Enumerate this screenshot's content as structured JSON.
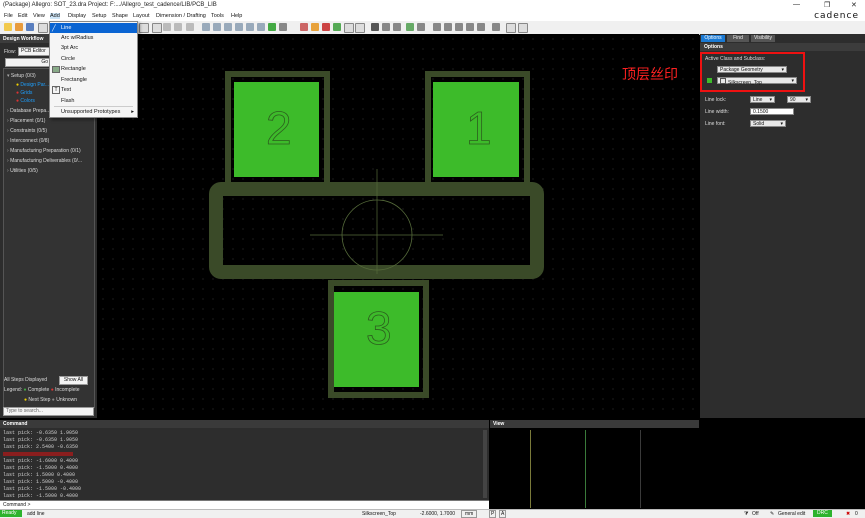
{
  "window": {
    "title": "(Package) Allegro: SOT_23.dra  Project: F:.../Allegro_test_cadence/LIB/PCB_LIB",
    "controls": [
      "—",
      "❐",
      "✕"
    ]
  },
  "menubar": {
    "items": [
      "File",
      "Edit",
      "View",
      "Add",
      "Display",
      "Setup",
      "Shape",
      "Layout",
      "Dimension / Drafting",
      "Tools",
      "Help"
    ],
    "brand": "cadence"
  },
  "add_menu": {
    "items": [
      "Line",
      "Arc w/Radius",
      "3pt Arc",
      "Circle",
      "Rectangle",
      "Frectangle",
      "Text",
      "Flash",
      "Unsupported Prototypes"
    ],
    "highlighted": "Line"
  },
  "left_panel": {
    "title": "Design Workflow",
    "flow_label": "Flow:",
    "flow_value": "PCB Editor",
    "goto_label": "Go To",
    "tree": [
      {
        "label": "Setup  (0/3)"
      },
      {
        "label": "Design Par..."
      },
      {
        "label": "Grids"
      },
      {
        "label": "Colors"
      },
      {
        "label": "Database Prepa..."
      },
      {
        "label": "Placement  (0/1)"
      },
      {
        "label": "Constraints  (0/5)"
      },
      {
        "label": "Interconnect  (0/8)"
      },
      {
        "label": "Manufacturing Preparation  (0/1)"
      },
      {
        "label": "Manufacturing Deliverables  (0/..."
      },
      {
        "label": "Utilities  (0/5)"
      }
    ],
    "steps_displayed": "All Steps Displayed",
    "show_all": "Show All",
    "legend": "Legend:",
    "legend_complete": "Complete",
    "legend_incomplete": "Incomplete",
    "legend_next": "Next Step",
    "legend_unknown": "Unknown",
    "search_placeholder": "Type to search..."
  },
  "right_panel": {
    "tabs": [
      "Options",
      "Find",
      "Visibility"
    ],
    "header": "Options",
    "active_class_label": "Active Class and Subclass:",
    "class_value": "Package Geometry",
    "subclass_value": "Silkscreen_Top",
    "line_lock_label": "Line lock:",
    "line_lock_value": "Line",
    "line_lock_angle": "90",
    "line_width_label": "Line width:",
    "line_width_value": "0.1500",
    "line_font_label": "Line font:",
    "line_font_value": "Solid",
    "annotation": "顶层丝印"
  },
  "canvas": {
    "pad_numbers": [
      "2",
      "1",
      "3"
    ]
  },
  "command_panel": {
    "title": "Command",
    "lines": [
      "last pick:  -0.6350 1.9050",
      "last pick:  -0.6350 1.9050",
      "last pick:  2.5400 -0.6350",
      "last pick:  -1.6000 0.4000",
      "last pick:  -1.5000 0.4000",
      "last pick:  1.5000 0.4000",
      "last pick:  1.5000 -0.4000",
      "last pick:  -1.5000 -0.4000",
      "last pick:  -1.5000 0.4000"
    ],
    "prompt": "Command >"
  },
  "view_panel": {
    "title": "View"
  },
  "statusbar": {
    "state": "Ready",
    "command": "add line",
    "subclass": "Silkscreen_Top",
    "coords": "-2.6000, 1.7000",
    "units": "mm",
    "p_btn": "P",
    "a_btn": "A",
    "filter": "Off",
    "edit_mode": "General edit",
    "drc": "DRC",
    "count": "0"
  },
  "colors": {
    "pad_green": "#3dbb2a",
    "silk_dark": "#3a4a28",
    "annotation_red": "#ff2020",
    "highlight_blue": "#0a64d2"
  }
}
